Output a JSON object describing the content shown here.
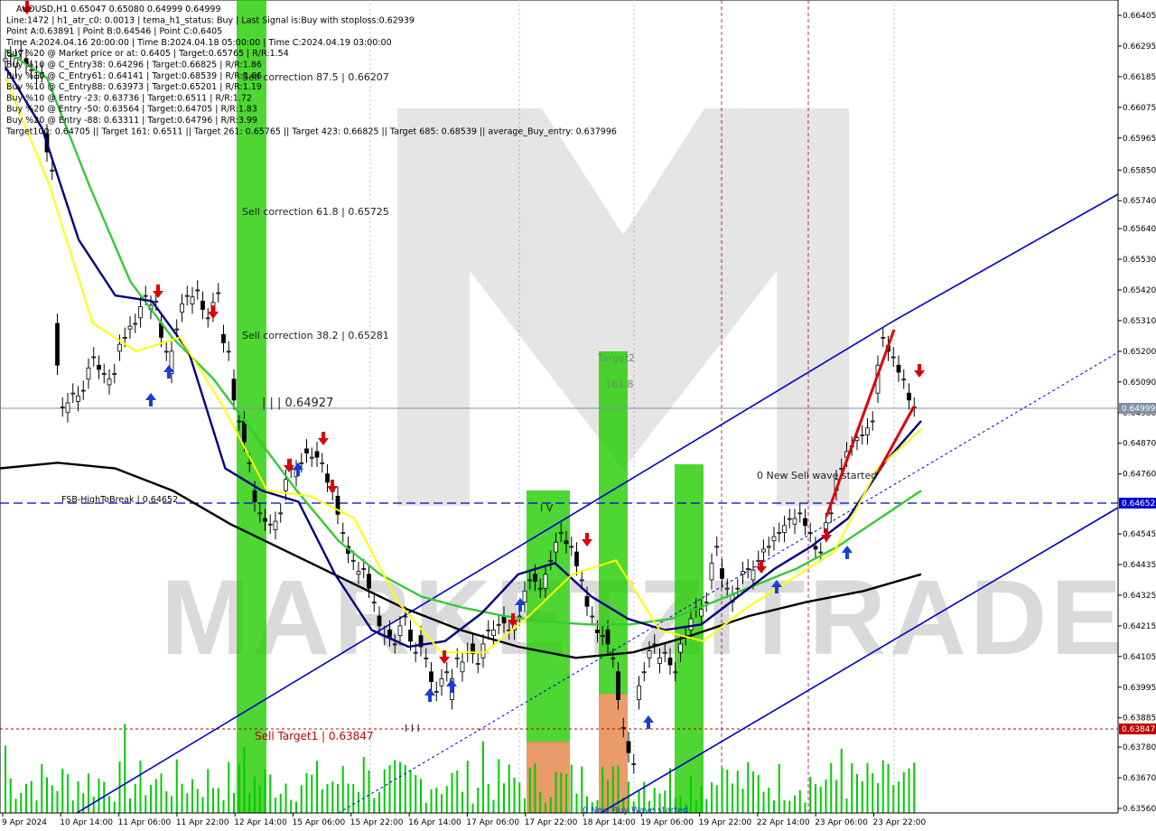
{
  "info_lines": [
    "AUDUSD,H1  0.65047 0.65080 0.64999 0.64999",
    "Line:1472 | h1_atr_c0: 0.0013 | tema_h1_status: Buy | Last Signal is:Buy with stoploss:0.62939",
    "Point A:0.63891 | Point B:0.64546 | Point C:0.6405",
    "Time A:2024.04.16 20:00:00 | Time B:2024.04.18 05:00:00 | Time C:2024.04.19 03:00:00",
    "Buy %20 @ Market price or at: 0.6405 | Target:0.65765 | R/R:1.54",
    "Buy %10 @ C_Entry38: 0.64296 | Target:0.66825 | R/R:1.86",
    "Buy %10 @ C_Entry61: 0.64141 | Target:0.68539 | R/R:3.66",
    "Buy %10 @ C_Entry88: 0.63973 | Target:0.65201 | R/R:1.19",
    "Buy %10 @ Entry -23: 0.63736 | Target:0.6511 | R/R:1.72",
    "Buy %20 @ Entry -50: 0.63564 | Target:0.64705 | R/R:1.83",
    "Buy %20 @ Entry -88: 0.63311 | Target:0.64796 | R/R:3.99",
    "Target100: 0.64705 || Target 161: 0.6511 || Target 261: 0.65765 || Target 423: 0.66825 || Target 685: 0.68539 || average_Buy_entry: 0.637996"
  ],
  "annotations": {
    "sell_correction_875": "Sell correction 87.5 | 0.66207",
    "sell_correction_618": "Sell correction 61.8 | 0.65725",
    "sell_correction_382": "Sell correction 38.2 | 0.65281",
    "level_0_64927": "| | | 0.64927",
    "fsb_high": "FSB-HighToBreak | 0.64652",
    "sell_target1": "Sell Target1 | 0.63847",
    "new_sell_wave": "0 New Sell wave started",
    "target2": "Target2",
    "target_161": "161.8",
    "iv": "I V",
    "iii": "I I I",
    "bottom_wave": "0 New Buy Wave started"
  },
  "price_boxes": {
    "current": "0.64999",
    "fsb": "0.64652",
    "target": "0.63847"
  },
  "watermark": "MARKETZITRADE",
  "colors": {
    "ema_black": "#000000",
    "ema_green": "#33cc33",
    "ema_navy": "#000080",
    "ema_yellow": "#ffff00",
    "channel": "#0000cc",
    "zone_green": "#22cc00",
    "zone_orange": "#e8905a",
    "sell_arrow": "#dd0000",
    "buy_arrow": "#1a3fd0",
    "volume": "#00cc00"
  },
  "chart_data": {
    "type": "candlestick",
    "symbol": "AUDUSD",
    "timeframe": "H1",
    "ohlc_last": {
      "open": 0.65047,
      "high": 0.6508,
      "low": 0.64999,
      "close": 0.64999
    },
    "y_ticks": [
      "0.66405",
      "0.66295",
      "0.66185",
      "0.66075",
      "0.65965",
      "0.65850",
      "0.65740",
      "0.65640",
      "0.65530",
      "0.65420",
      "0.65310",
      "0.65200",
      "0.65090",
      "0.64980",
      "0.64870",
      "0.64760",
      "0.64545",
      "0.64435",
      "0.64325",
      "0.64215",
      "0.64105",
      "0.63995",
      "0.63885",
      "0.63780",
      "0.63670",
      "0.63560"
    ],
    "x_ticks": [
      "9 Apr 2024",
      "10 Apr 14:00",
      "11 Apr 06:00",
      "11 Apr 22:00",
      "12 Apr 14:00",
      "15 Apr 06:00",
      "15 Apr 22:00",
      "16 Apr 14:00",
      "17 Apr 06:00",
      "17 Apr 22:00",
      "18 Apr 14:00",
      "19 Apr 06:00",
      "19 Apr 22:00",
      "22 Apr 14:00",
      "23 Apr 06:00",
      "23 Apr 22:00"
    ],
    "ylim": [
      0.6353,
      0.6646
    ],
    "close_path": [
      [
        0.6624,
        0.6626
      ],
      [
        0.6622,
        0.6628
      ],
      [
        0.6625,
        0.6621
      ],
      [
        0.6618,
        0.662
      ],
      [
        0.6598,
        0.6585
      ],
      [
        0.653,
        0.65
      ],
      [
        0.6498,
        0.6505
      ],
      [
        0.6502,
        0.6506
      ],
      [
        0.651,
        0.6518
      ],
      [
        0.6515,
        0.6512
      ],
      [
        0.6508,
        0.6512
      ],
      [
        0.652,
        0.6525
      ],
      [
        0.6528,
        0.653
      ],
      [
        0.6532,
        0.654
      ],
      [
        0.6535,
        0.6538
      ],
      [
        0.653,
        0.652
      ],
      [
        0.6512,
        0.6528
      ],
      [
        0.6534,
        0.654
      ],
      [
        0.6537,
        0.6542
      ],
      [
        0.6538,
        0.6532
      ],
      [
        0.6534,
        0.6541
      ],
      [
        0.6526,
        0.652
      ],
      [
        0.651,
        0.6495
      ],
      [
        0.6495,
        0.648
      ],
      [
        0.647,
        0.6462
      ],
      [
        0.646,
        0.6458
      ],
      [
        0.6456,
        0.6462
      ],
      [
        0.647,
        0.6478
      ],
      [
        0.6475,
        0.648
      ],
      [
        0.6485,
        0.6482
      ],
      [
        0.6484,
        0.648
      ],
      [
        0.6476,
        0.647
      ],
      [
        0.6468,
        0.6455
      ],
      [
        0.645,
        0.6445
      ],
      [
        0.644,
        0.6442
      ],
      [
        0.644,
        0.643
      ],
      [
        0.6425,
        0.6418
      ],
      [
        0.642,
        0.6415
      ],
      [
        0.6418,
        0.6425
      ],
      [
        0.642,
        0.6412
      ],
      [
        0.6418,
        0.641
      ],
      [
        0.6405,
        0.6398
      ],
      [
        0.64,
        0.6405
      ],
      [
        0.6395,
        0.641
      ],
      [
        0.6405,
        0.6412
      ],
      [
        0.6415,
        0.6408
      ],
      [
        0.641,
        0.642
      ],
      [
        0.6418,
        0.6422
      ],
      [
        0.6425,
        0.642
      ],
      [
        0.642,
        0.6425
      ],
      [
        0.643,
        0.6438
      ],
      [
        0.644,
        0.6435
      ],
      [
        0.6435,
        0.6445
      ],
      [
        0.6448,
        0.6455
      ],
      [
        0.6452,
        0.645
      ],
      [
        0.6448,
        0.6438
      ],
      [
        0.6432,
        0.6425
      ],
      [
        0.642,
        0.6418
      ],
      [
        0.642,
        0.641
      ],
      [
        0.6405,
        0.6385
      ],
      [
        0.638,
        0.6372
      ],
      [
        0.6395,
        0.6405
      ],
      [
        0.641,
        0.6415
      ],
      [
        0.6408,
        0.6412
      ],
      [
        0.641,
        0.6405
      ],
      [
        0.6412,
        0.6418
      ],
      [
        0.642,
        0.6428
      ],
      [
        0.6425,
        0.643
      ],
      [
        0.6438,
        0.645
      ],
      [
        0.6442,
        0.6435
      ],
      [
        0.643,
        0.6435
      ],
      [
        0.644,
        0.6442
      ],
      [
        0.6438,
        0.6445
      ],
      [
        0.6448,
        0.645
      ],
      [
        0.6452,
        0.6455
      ],
      [
        0.6455,
        0.646
      ],
      [
        0.6458,
        0.6462
      ],
      [
        0.646,
        0.6455
      ],
      [
        0.645,
        0.6448
      ],
      [
        0.6455,
        0.6462
      ],
      [
        0.647,
        0.6478
      ],
      [
        0.6482,
        0.6486
      ],
      [
        0.6488,
        0.649
      ],
      [
        0.649,
        0.6495
      ],
      [
        0.6505,
        0.6525
      ],
      [
        0.6522,
        0.6518
      ],
      [
        0.6515,
        0.651
      ],
      [
        0.6505,
        0.65
      ]
    ],
    "ema_black": [
      0.6478,
      0.648,
      0.6478,
      0.647,
      0.6458,
      0.6448,
      0.6438,
      0.6428,
      0.642,
      0.6414,
      0.641,
      0.6412,
      0.6418,
      0.6425,
      0.643,
      0.6434,
      0.644
    ],
    "ema_green": [
      0.6628,
      0.6618,
      0.658,
      0.6545,
      0.6525,
      0.651,
      0.649,
      0.647,
      0.6452,
      0.644,
      0.6432,
      0.6428,
      0.6425,
      0.6423,
      0.6422,
      0.6422,
      0.6424,
      0.643,
      0.6436,
      0.6442,
      0.645,
      0.646,
      0.647
    ],
    "ema_navy": [
      0.6622,
      0.66,
      0.656,
      0.654,
      0.6538,
      0.652,
      0.6478,
      0.647,
      0.6466,
      0.644,
      0.642,
      0.6414,
      0.6416,
      0.6426,
      0.644,
      0.6444,
      0.6432,
      0.6424,
      0.642,
      0.6422,
      0.6432,
      0.6442,
      0.645,
      0.646,
      0.648,
      0.6495
    ],
    "ema_yellow": [
      0.6618,
      0.658,
      0.653,
      0.652,
      0.6525,
      0.65,
      0.647,
      0.6468,
      0.646,
      0.643,
      0.6412,
      0.6412,
      0.6425,
      0.644,
      0.6445,
      0.642,
      0.6416,
      0.6428,
      0.6438,
      0.6448,
      0.6478,
      0.6492
    ]
  }
}
